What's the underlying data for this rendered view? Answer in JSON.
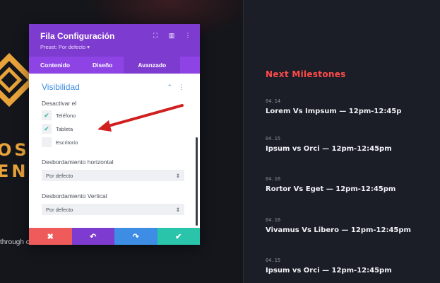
{
  "background": {
    "big_text_1": "OS",
    "big_text_2": "EN",
    "through_text": "through c"
  },
  "milestones": {
    "title": "Next Milestones",
    "items": [
      {
        "date": "04.14",
        "text": "Lorem Vs Impsum — 12pm-12:45p"
      },
      {
        "date": "04.15",
        "text": "Ipsum vs Orci — 12pm-12:45pm"
      },
      {
        "date": "04.16",
        "text": "Rortor Vs Eget — 12pm-12:45pm"
      },
      {
        "date": "04.16",
        "text": "Vivamus Vs Libero — 12pm-12:45pm"
      },
      {
        "date": "04.15",
        "text": "Ipsum vs Orci — 12pm-12:45pm"
      }
    ]
  },
  "panel": {
    "title": "Fila Configuración",
    "preset": "Preset: Por defecto ▾",
    "icons": {
      "focus": "focus-icon",
      "layout": "columns-icon",
      "more": "more-vertical-icon"
    },
    "tabs": [
      "Contenido",
      "Diseño",
      "Avanzado"
    ],
    "active_tab": "Avanzado",
    "section": {
      "title": "Visibilidad",
      "disable_label": "Desactivar el",
      "options": [
        {
          "label": "Teléfono",
          "checked": true
        },
        {
          "label": "Tableta",
          "checked": true
        },
        {
          "label": "Escritorio",
          "checked": false
        }
      ],
      "overflow_h_label": "Desbordamiento horizontal",
      "overflow_h_value": "Por defecto",
      "overflow_v_label": "Desbordamiento Vertical",
      "overflow_v_value": "Por defecto"
    },
    "footer": {
      "cancel_icon": "✖",
      "undo_icon": "↶",
      "redo_icon": "↷",
      "save_icon": "✔"
    },
    "colors": {
      "header": "#7e3bd0",
      "tabs": "#8e44e5",
      "accent": "#3d8de0",
      "cancel": "#ef5b5b",
      "undo": "#7e3bd0",
      "redo": "#3c8de3",
      "save": "#29c4a9",
      "annotation_arrow": "#d11f1f"
    }
  }
}
